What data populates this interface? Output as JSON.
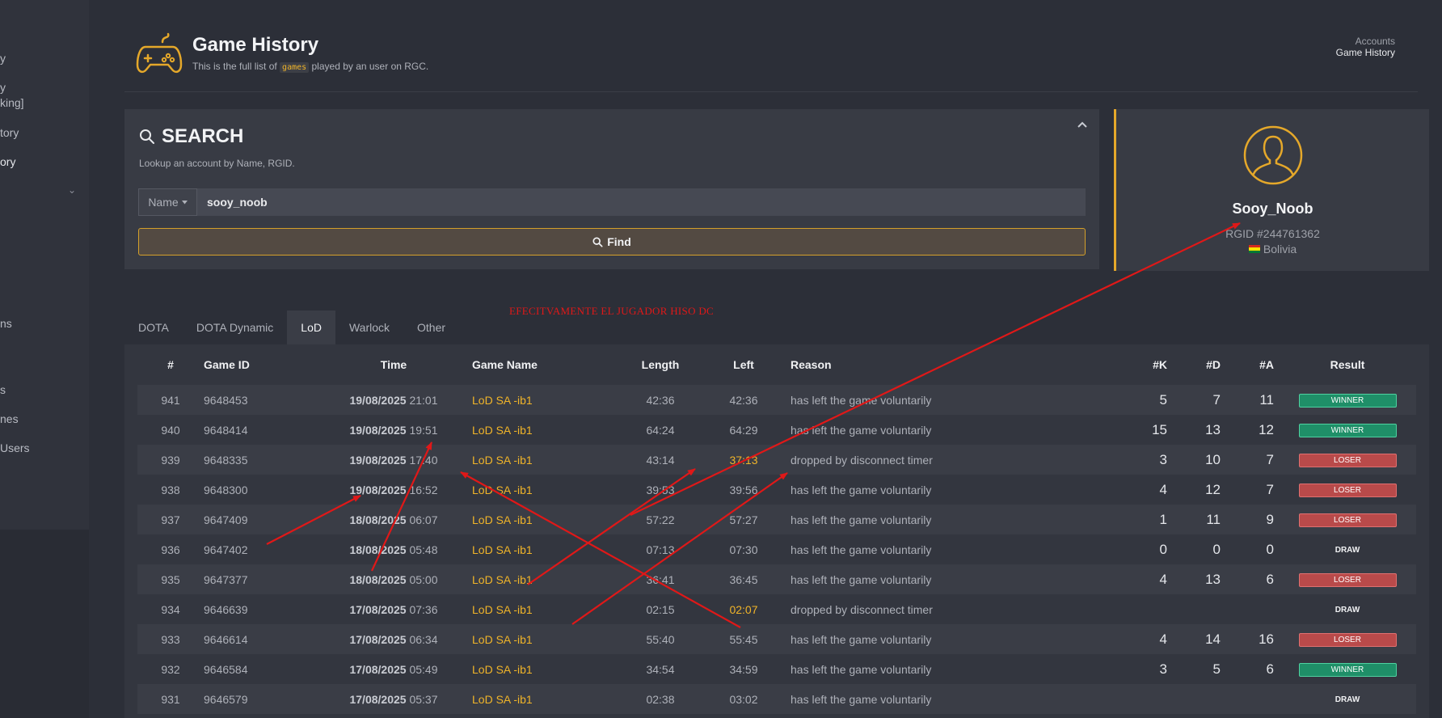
{
  "sidebar": {
    "items": [
      {
        "label": "y",
        "active": false
      },
      {
        "label": "y",
        "active": false
      },
      {
        "label": "king]",
        "active": false
      },
      {
        "label": "tory",
        "active": false
      },
      {
        "label": "ory",
        "active": true
      },
      {
        "label": "ns",
        "active": false
      },
      {
        "label": "s",
        "active": false
      },
      {
        "label": "nes",
        "active": false
      },
      {
        "label": "Users",
        "active": false
      }
    ],
    "chevron": "⌄"
  },
  "header": {
    "title": "Game History",
    "subtitle_before": "This is the full list of",
    "subtitle_code": "games",
    "subtitle_after": "played by an user on RGC.",
    "breadcrumb_parent": "Accounts",
    "breadcrumb_current": "Game History"
  },
  "search": {
    "title": "SEARCH",
    "description": "Lookup an account by Name, RGID.",
    "type_label": "Name",
    "value": "sooy_noob",
    "find_label": "Find"
  },
  "profile": {
    "name": "Sooy_Noob",
    "rgid": "RGID #244761362",
    "country": "Bolivia"
  },
  "annotation": "EFECITVAMENTE EL JUGADOR HISO DC",
  "tabs": [
    {
      "label": "DOTA",
      "active": false
    },
    {
      "label": "DOTA Dynamic",
      "active": false
    },
    {
      "label": "LoD",
      "active": true
    },
    {
      "label": "Warlock",
      "active": false
    },
    {
      "label": "Other",
      "active": false
    }
  ],
  "table": {
    "headers": [
      "#",
      "Game ID",
      "Time",
      "Game Name",
      "Length",
      "Left",
      "Reason",
      "#K",
      "#D",
      "#A",
      "Result"
    ],
    "rows": [
      {
        "idx": "941",
        "game_id": "9648453",
        "date": "19/08/2025",
        "time": "21:01",
        "game_name": "LoD SA -ib1",
        "length": "42:36",
        "left": "42:36",
        "left_warn": false,
        "reason": "has left the game voluntarily",
        "k": "5",
        "d": "7",
        "a": "11",
        "result": "WINNER",
        "result_type": "win"
      },
      {
        "idx": "940",
        "game_id": "9648414",
        "date": "19/08/2025",
        "time": "19:51",
        "game_name": "LoD SA -ib1",
        "length": "64:24",
        "left": "64:29",
        "left_warn": false,
        "reason": "has left the game voluntarily",
        "k": "15",
        "d": "13",
        "a": "12",
        "result": "WINNER",
        "result_type": "win"
      },
      {
        "idx": "939",
        "game_id": "9648335",
        "date": "19/08/2025",
        "time": "17:40",
        "game_name": "LoD SA -ib1",
        "length": "43:14",
        "left": "37:13",
        "left_warn": true,
        "reason": "dropped by disconnect timer",
        "k": "3",
        "d": "10",
        "a": "7",
        "result": "LOSER",
        "result_type": "lose"
      },
      {
        "idx": "938",
        "game_id": "9648300",
        "date": "19/08/2025",
        "time": "16:52",
        "game_name": "LoD SA -ib1",
        "length": "39:53",
        "left": "39:56",
        "left_warn": false,
        "reason": "has left the game voluntarily",
        "k": "4",
        "d": "12",
        "a": "7",
        "result": "LOSER",
        "result_type": "lose"
      },
      {
        "idx": "937",
        "game_id": "9647409",
        "date": "18/08/2025",
        "time": "06:07",
        "game_name": "LoD SA -ib1",
        "length": "57:22",
        "left": "57:27",
        "left_warn": false,
        "reason": "has left the game voluntarily",
        "k": "1",
        "d": "11",
        "a": "9",
        "result": "LOSER",
        "result_type": "lose"
      },
      {
        "idx": "936",
        "game_id": "9647402",
        "date": "18/08/2025",
        "time": "05:48",
        "game_name": "LoD SA -ib1",
        "length": "07:13",
        "left": "07:30",
        "left_warn": false,
        "reason": "has left the game voluntarily",
        "k": "0",
        "d": "0",
        "a": "0",
        "result": "DRAW",
        "result_type": "draw"
      },
      {
        "idx": "935",
        "game_id": "9647377",
        "date": "18/08/2025",
        "time": "05:00",
        "game_name": "LoD SA -ib1",
        "length": "36:41",
        "left": "36:45",
        "left_warn": false,
        "reason": "has left the game voluntarily",
        "k": "4",
        "d": "13",
        "a": "6",
        "result": "LOSER",
        "result_type": "lose"
      },
      {
        "idx": "934",
        "game_id": "9646639",
        "date": "17/08/2025",
        "time": "07:36",
        "game_name": "LoD SA -ib1",
        "length": "02:15",
        "left": "02:07",
        "left_warn": true,
        "reason": "dropped by disconnect timer",
        "k": "",
        "d": "",
        "a": "",
        "result": "DRAW",
        "result_type": "draw"
      },
      {
        "idx": "933",
        "game_id": "9646614",
        "date": "17/08/2025",
        "time": "06:34",
        "game_name": "LoD SA -ib1",
        "length": "55:40",
        "left": "55:45",
        "left_warn": false,
        "reason": "has left the game voluntarily",
        "k": "4",
        "d": "14",
        "a": "16",
        "result": "LOSER",
        "result_type": "lose"
      },
      {
        "idx": "932",
        "game_id": "9646584",
        "date": "17/08/2025",
        "time": "05:49",
        "game_name": "LoD SA -ib1",
        "length": "34:54",
        "left": "34:59",
        "left_warn": false,
        "reason": "has left the game voluntarily",
        "k": "3",
        "d": "5",
        "a": "6",
        "result": "WINNER",
        "result_type": "win"
      },
      {
        "idx": "931",
        "game_id": "9646579",
        "date": "17/08/2025",
        "time": "05:37",
        "game_name": "LoD SA -ib1",
        "length": "02:38",
        "left": "03:02",
        "left_warn": false,
        "reason": "has left the game voluntarily",
        "k": "",
        "d": "",
        "a": "",
        "result": "DRAW",
        "result_type": "draw"
      }
    ]
  },
  "colors": {
    "accent": "#f0b429",
    "winner": "#1f8f68",
    "loser": "#b94a4a",
    "annotation": "#e01818"
  }
}
